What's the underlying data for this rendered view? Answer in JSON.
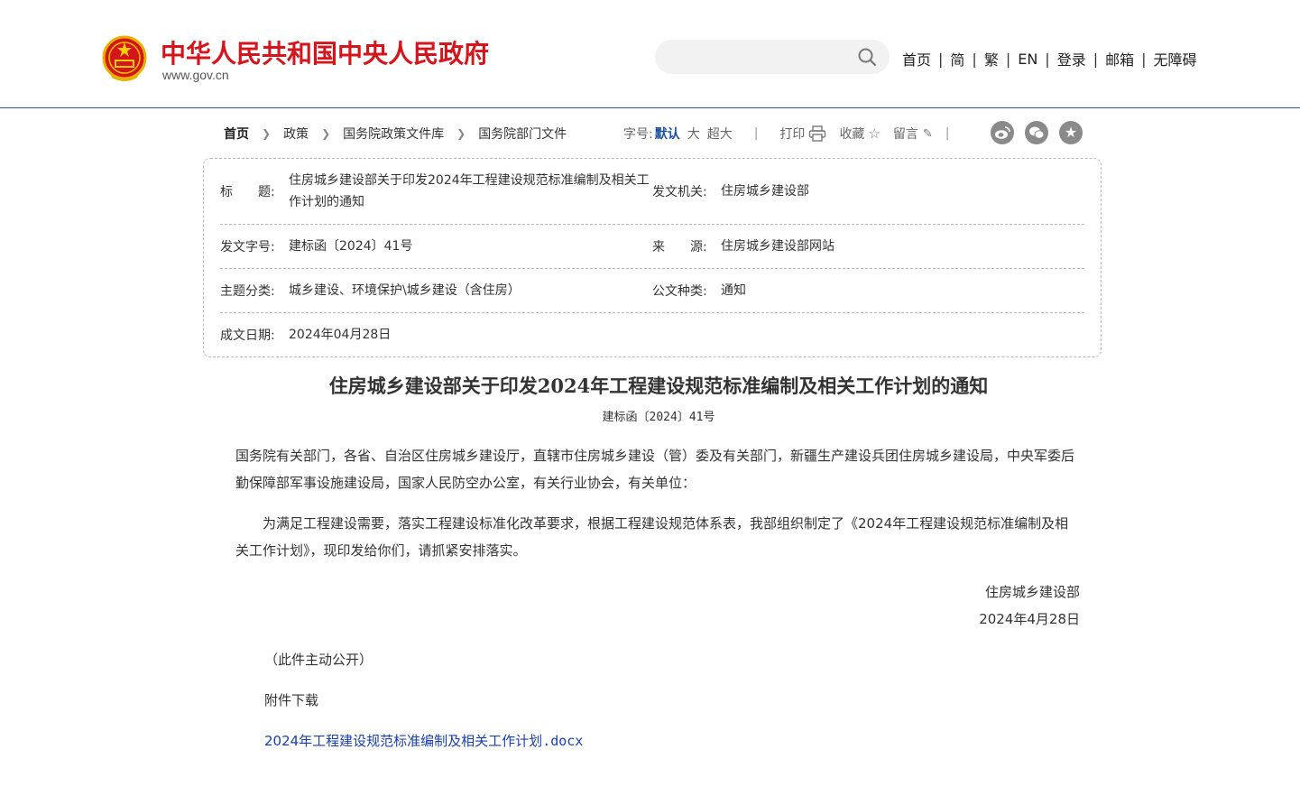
{
  "header": {
    "site_title": "中华人民共和国中央人民政府",
    "site_url": "www.gov.cn",
    "search_placeholder": "",
    "nav": [
      "首页",
      "简",
      "繁",
      "EN",
      "登录",
      "邮箱",
      "无障碍"
    ],
    "nav_separator": "|"
  },
  "toolbar": {
    "breadcrumb": [
      "首页",
      "政策",
      "国务院政策文件库",
      "国务院部门文件"
    ],
    "font_size_label": "字号:",
    "font_sizes": [
      "默认",
      "大",
      "超大"
    ],
    "print_label": "打印",
    "collect_label": "收藏",
    "comment_label": "留言",
    "separator": "|",
    "share_icons": [
      "weibo-icon",
      "wechat-icon",
      "favorite-icon"
    ]
  },
  "info": {
    "title_label": "标　　题:",
    "title_value": "住房城乡建设部关于印发2024年工程建设规范标准编制及相关工作计划的通知",
    "issuer_label": "发文机关:",
    "issuer_value": "住房城乡建设部",
    "doc_no_label": "发文字号:",
    "doc_no_value": "建标函〔2024〕41号",
    "source_label": "来　　源:",
    "source_value": "住房城乡建设部网站",
    "topic_label": "主题分类:",
    "topic_value": "城乡建设、环境保护\\城乡建设（含住房）",
    "type_label": "公文种类:",
    "type_value": "通知",
    "date_label": "成文日期:",
    "date_value": "2024年04月28日"
  },
  "article": {
    "title": "住房城乡建设部关于印发2024年工程建设规范标准编制及相关工作计划的通知",
    "doc_number": "建标函〔2024〕41号",
    "addressee": "国务院有关部门，各省、自治区住房城乡建设厅，直辖市住房城乡建设（管）委及有关部门，新疆生产建设兵团住房城乡建设局，中央军委后勤保障部军事设施建设局，国家人民防空办公室，有关行业协会，有关单位：",
    "body": "为满足工程建设需要，落实工程建设标准化改革要求，根据工程建设规范体系表，我部组织制定了《2024年工程建设规范标准编制及相关工作计划》，现印发给你们，请抓紧安排落实。",
    "signer": "住房城乡建设部",
    "sign_date": "2024年4月28日",
    "disclosure": "（此件主动公开）",
    "attachment_heading": "附件下载",
    "attachment_name": "2024年工程建设规范标准编制及相关工作计划",
    "attachment_ext": ".docx"
  },
  "colors": {
    "brand_red": "#d4151c",
    "header_rule": "#2b5797",
    "link_blue": "#1a3fa8",
    "active_font": "#1a4f9c"
  }
}
